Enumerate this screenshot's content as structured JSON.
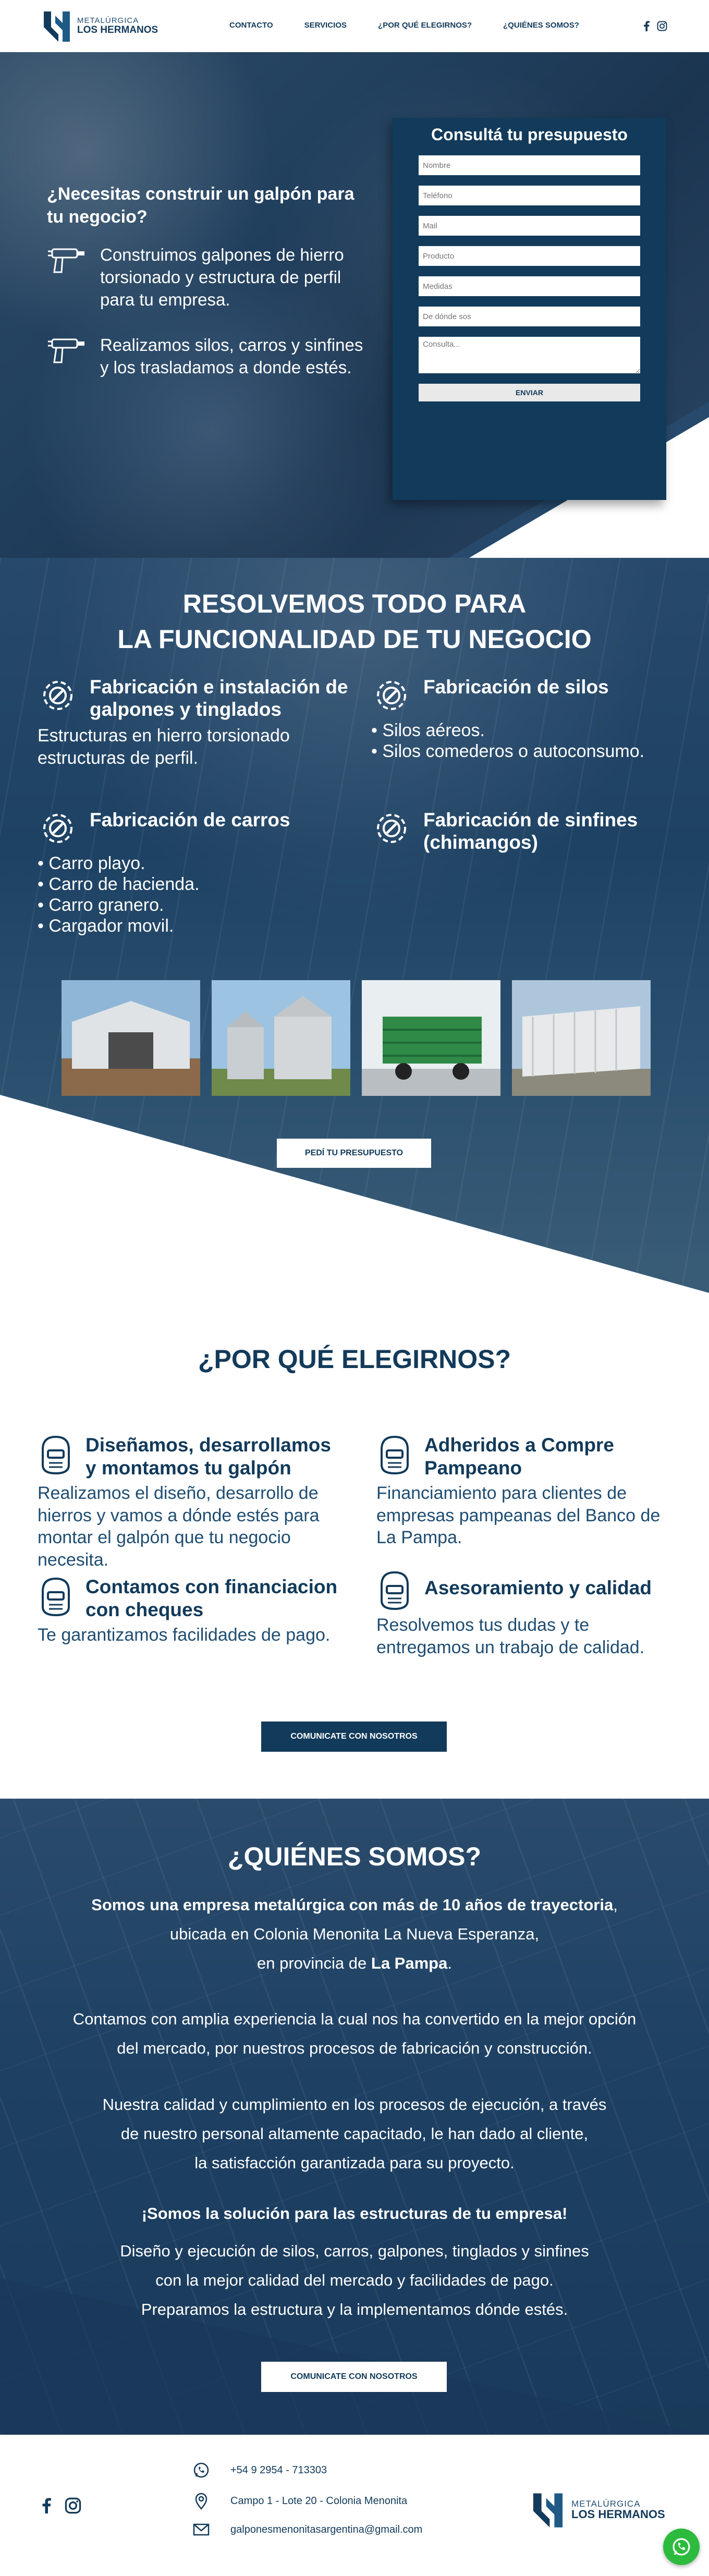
{
  "brand": {
    "line1": "METALÚRGICA",
    "line2": "LOS HERMANOS",
    "color_primary": "#123a5a",
    "color_whatsapp": "#2dbb3f"
  },
  "nav": [
    "CONTACTO",
    "SERVICIOS",
    "¿POR QUÉ ELEGIRNOS?",
    "¿QUIÉNES SOMOS?"
  ],
  "social_icons": [
    "facebook-icon",
    "instagram-icon"
  ],
  "hero": {
    "title": "¿Necesitas construir un galpón para tu negocio?",
    "features": [
      "Construimos galpones de hierro torsionado y estructura de perfil para tu empresa.",
      "Realizamos silos, carros y sinfines y los trasladamos a donde estés."
    ]
  },
  "quote_form": {
    "title": "Consultá tu presupuesto",
    "placeholders": [
      "Nombre",
      "Teléfono",
      "Mail",
      "Producto",
      "Medidas",
      "De dónde sos",
      "Consulta..."
    ],
    "submit": "ENVIAR"
  },
  "services": {
    "title_line1": "RESOLVEMOS TODO PARA",
    "title_line2": "LA FUNCIONALIDAD DE TU NEGOCIO",
    "items": [
      {
        "title": "Fabricación e instalación de galpones y tinglados",
        "text": "Estructuras en hierro torsionado estructuras de perfil."
      },
      {
        "title": "Fabricación de silos",
        "list": [
          "Silos aéreos.",
          "Silos comederos o autoconsumo."
        ]
      },
      {
        "title": "Fabricación de carros",
        "list": [
          "Carro playo.",
          "Carro de hacienda.",
          "Carro granero.",
          "Cargador movil."
        ]
      },
      {
        "title": "Fabricación de sinfines (chimangos)"
      }
    ],
    "cta": "PEDÍ TU PRESUPUESTO"
  },
  "why": {
    "title": "¿POR QUÉ ELEGIRNOS?",
    "items": [
      {
        "title": "Diseñamos, desarrollamos y montamos tu galpón",
        "text": "Realizamos el diseño, desarrollo de hierros y vamos a dónde estés para montar el galpón que tu negocio necesita."
      },
      {
        "title": "Adheridos a Compre Pampeano",
        "text": "Financiamiento para clientes de empresas pampeanas del Banco de La Pampa."
      },
      {
        "title": "Contamos con financiacion con cheques",
        "text": "Te garantizamos facilidades de pago."
      },
      {
        "title": "Asesoramiento y calidad",
        "text": "Resolvemos tus dudas y te entregamos un trabajo de calidad."
      }
    ],
    "cta": "COMUNICATE CON NOSOTROS"
  },
  "about": {
    "title": "¿QUIÉNES SOMOS?",
    "p1_bold": "Somos una empresa metalúrgica con más de 10 años de trayectoria",
    "p1_comma": ",",
    "p1_line2": "ubicada en Colonia Menonita La Nueva Esperanza,",
    "p1_line3_pre": "en provincia de ",
    "p1_line3_bold": "La Pampa",
    "p1_line3_post": ".",
    "p2_line1": "Contamos con amplia experiencia la cual nos ha convertido en la mejor opción",
    "p2_line2": "del mercado, por nuestros procesos de fabricación y construcción.",
    "p3_line1": "Nuestra calidad y cumplimiento en los procesos de ejecución, a través",
    "p3_line2": "de nuestro personal altamente capacitado, le han dado al cliente,",
    "p3_line3": "la satisfacción garantizada para su proyecto.",
    "slogan": "¡Somos la solución para las estructuras de tu empresa!",
    "p4_line1": "Diseño y ejecución de silos, carros, galpones, tinglados y sinfines",
    "p4_line2": "con la mejor calidad del mercado y facilidades de pago.",
    "p4_line3": "Preparamos la estructura y la implementamos dónde estés.",
    "cta": "COMUNICATE CON NOSOTROS"
  },
  "footer": {
    "phone": "+54 9 2954 - 713303",
    "address": "Campo 1 - Lote 20 - Colonia Menonita",
    "email": "galponesmenonitasargentina@gmail.com"
  }
}
